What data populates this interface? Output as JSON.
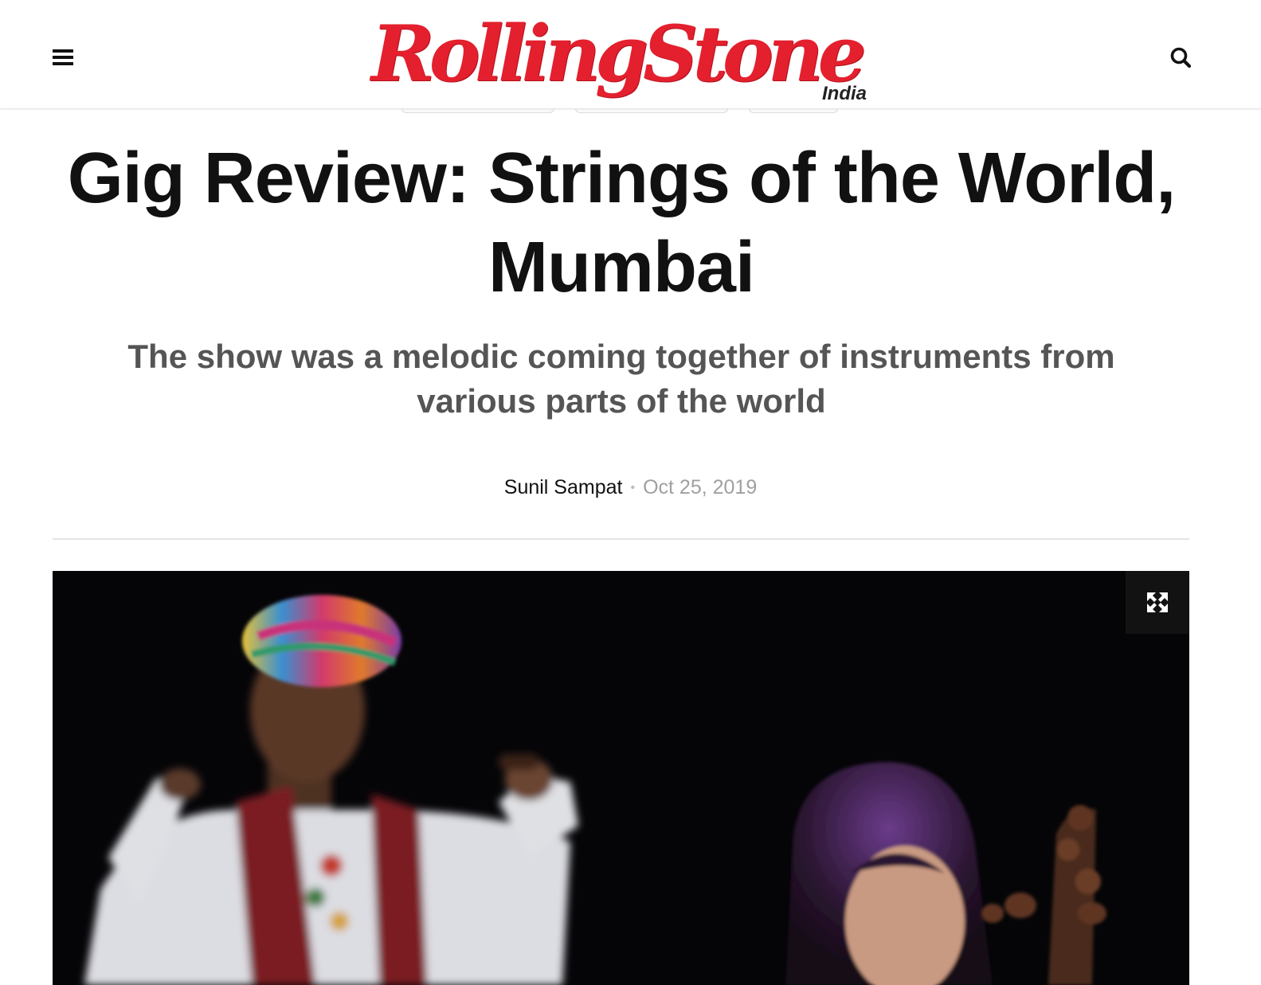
{
  "header": {
    "logo_text": "RollingStone",
    "logo_sub": "India",
    "menu_icon": "hamburger-icon",
    "search_icon": "search-icon",
    "brand_color": "#e4202e"
  },
  "article": {
    "title": "Gig Review: Strings of the World, Mumbai",
    "subtitle": "The show was a melodic coming together of instruments from various parts of the world",
    "author": "Sunil Sampat",
    "separator": "•",
    "date": "Oct 25, 2019"
  },
  "featured_image": {
    "expand_icon": "expand-icon"
  }
}
